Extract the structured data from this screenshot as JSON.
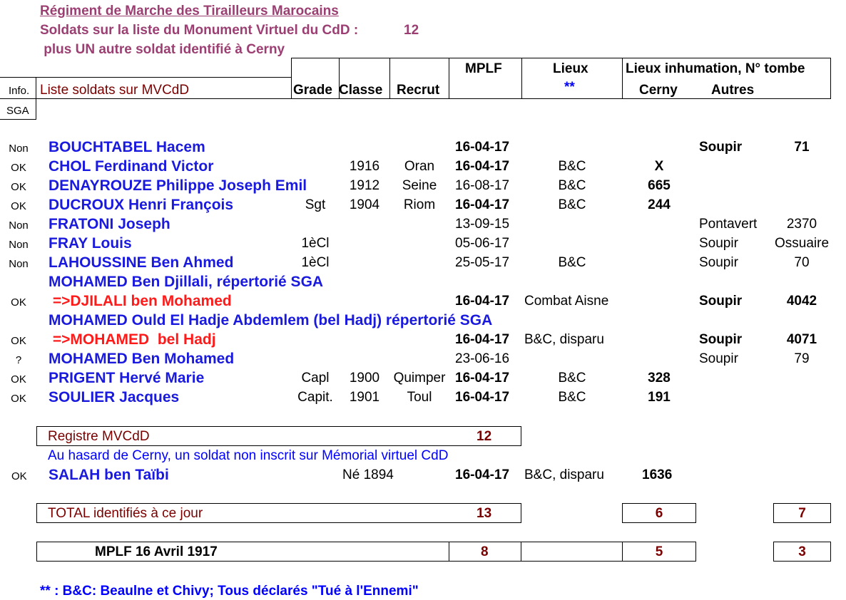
{
  "header": {
    "title": "Régiment de Marche des Tirailleurs Marocains",
    "subtitle": "Soldats sur la liste du Monument Virtuel du CdD :",
    "count": "12",
    "extra": " plus UN autre soldat identifié à Cerny"
  },
  "columns": {
    "info": "Info.",
    "sga": "SGA",
    "list": "Liste soldats sur MVCdD",
    "grade": "Grade",
    "classe": "Classe",
    "recrut": "Recrut",
    "mplf": "MPLF",
    "lieux": "Lieux",
    "lieux_note": "**",
    "inhumation": "Lieux inhumation, N° tombe",
    "cerny": "Cerny",
    "autres": "Autres"
  },
  "rows": [
    {
      "info": "Non",
      "name": "BOUCHTABEL Hacem",
      "grade": "",
      "classe": "",
      "recrut": "",
      "mplf": "16-04-17",
      "mplf_bold": true,
      "lieux": "",
      "cerny": "",
      "autre_lieu": "Soupir",
      "autre_lieu_bold": true,
      "autre_num": "71",
      "autre_num_bold": true
    },
    {
      "info": "OK",
      "name": "CHOL Ferdinand Victor",
      "grade": "",
      "classe": "1916",
      "recrut": "Oran",
      "mplf": "16-04-17",
      "mplf_bold": true,
      "lieux": "B&C",
      "cerny": "X",
      "autre_lieu": "",
      "autre_num": ""
    },
    {
      "info": "OK",
      "name": "DENAYROUZE Philippe Joseph Emil",
      "grade": "",
      "classe": "1912",
      "recrut": "Seine",
      "mplf": "16-08-17",
      "mplf_bold": false,
      "lieux": "B&C",
      "cerny": "665",
      "autre_lieu": "",
      "autre_num": ""
    },
    {
      "info": "OK",
      "name": "DUCROUX Henri François",
      "grade": "Sgt",
      "classe": "1904",
      "recrut": "Riom",
      "mplf": "16-04-17",
      "mplf_bold": true,
      "lieux": "B&C",
      "cerny": "244",
      "autre_lieu": "",
      "autre_num": ""
    },
    {
      "info": "Non",
      "name": "FRATONI Joseph",
      "grade": "",
      "classe": "",
      "recrut": "",
      "mplf": "13-09-15",
      "mplf_bold": false,
      "lieux": "",
      "cerny": "",
      "autre_lieu": "Pontavert",
      "autre_num": "2370"
    },
    {
      "info": "Non",
      "name": "FRAY Louis",
      "grade": "1èCl",
      "classe": "",
      "recrut": "",
      "mplf": "05-06-17",
      "mplf_bold": false,
      "lieux": "",
      "cerny": "",
      "autre_lieu": "Soupir",
      "autre_num": "Ossuaire"
    },
    {
      "info": "Non",
      "name": "LAHOUSSINE Ben Ahmed",
      "grade": "1èCl",
      "classe": "",
      "recrut": "",
      "mplf": "25-05-17",
      "mplf_bold": false,
      "lieux": "B&C",
      "cerny": "",
      "autre_lieu": "Soupir",
      "autre_num": "70"
    },
    {
      "info": "",
      "name": "MOHAMED Ben Djillali, répertorié SGA",
      "grade": "",
      "classe": "",
      "recrut": "",
      "mplf": "",
      "lieux": "",
      "cerny": "",
      "autre_lieu": "",
      "autre_num": ""
    },
    {
      "info": "OK",
      "name": " =>DJILALI ben Mohamed",
      "name_red": true,
      "grade": "",
      "classe": "",
      "recrut": "",
      "mplf": "16-04-17",
      "mplf_bold": true,
      "lieux": "Combat Aisne",
      "cerny": "",
      "autre_lieu": "Soupir",
      "autre_lieu_bold": true,
      "autre_num": "4042",
      "autre_num_bold": true
    },
    {
      "info": "",
      "name": "MOHAMED Ould El Hadje Abdemlem (bel Hadj) répertorié SGA",
      "grade": "",
      "classe": "",
      "recrut": "",
      "mplf": "",
      "lieux": "",
      "cerny": "",
      "autre_lieu": "",
      "autre_num": ""
    },
    {
      "info": "OK",
      "name": " =>MOHAMED  bel Hadj",
      "name_red": true,
      "grade": "",
      "classe": "",
      "recrut": "",
      "mplf": "16-04-17",
      "mplf_bold": true,
      "lieux": "B&C, disparu",
      "cerny": "",
      "autre_lieu": "Soupir",
      "autre_lieu_bold": true,
      "autre_num": "4071",
      "autre_num_bold": true
    },
    {
      "info": "?",
      "name": "MOHAMED Ben Mohamed",
      "grade": "",
      "classe": "",
      "recrut": "",
      "mplf": "23-06-16",
      "mplf_bold": false,
      "lieux": "",
      "cerny": "",
      "autre_lieu": "Soupir",
      "autre_num": "79"
    },
    {
      "info": "OK",
      "name": "PRIGENT Hervé Marie",
      "grade": "Capl",
      "classe": "1900",
      "recrut": "Quimper",
      "mplf": "16-04-17",
      "mplf_bold": true,
      "lieux": "B&C",
      "cerny": "328",
      "autre_lieu": "",
      "autre_num": ""
    },
    {
      "info": "OK",
      "name": "SOULIER Jacques",
      "grade": "Capit.",
      "classe": "1901",
      "recrut": "Toul",
      "mplf": "16-04-17",
      "mplf_bold": true,
      "lieux": "B&C",
      "cerny": "191",
      "autre_lieu": "",
      "autre_num": ""
    }
  ],
  "registre": {
    "label": "Registre MVCdD",
    "count": "12"
  },
  "hasard": {
    "note": "Au hasard de Cerny, un soldat non inscrit sur Mémorial virtuel CdD",
    "info": "OK",
    "name": "SALAH ben Taïbi",
    "ne": "Né 1894",
    "mplf": "16-04-17",
    "lieux": "B&C, disparu",
    "cerny": "1636"
  },
  "total": {
    "label": "TOTAL identifiés à ce jour",
    "count": "13",
    "cerny": "6",
    "autres": "7"
  },
  "mplf_total": {
    "label": "MPLF 16 Avril 1917",
    "count": "8",
    "cerny": "5",
    "autres": "3"
  },
  "footnote": "** : B&C: Beaulne et Chivy; Tous déclarés \"Tué à l'Ennemi\""
}
